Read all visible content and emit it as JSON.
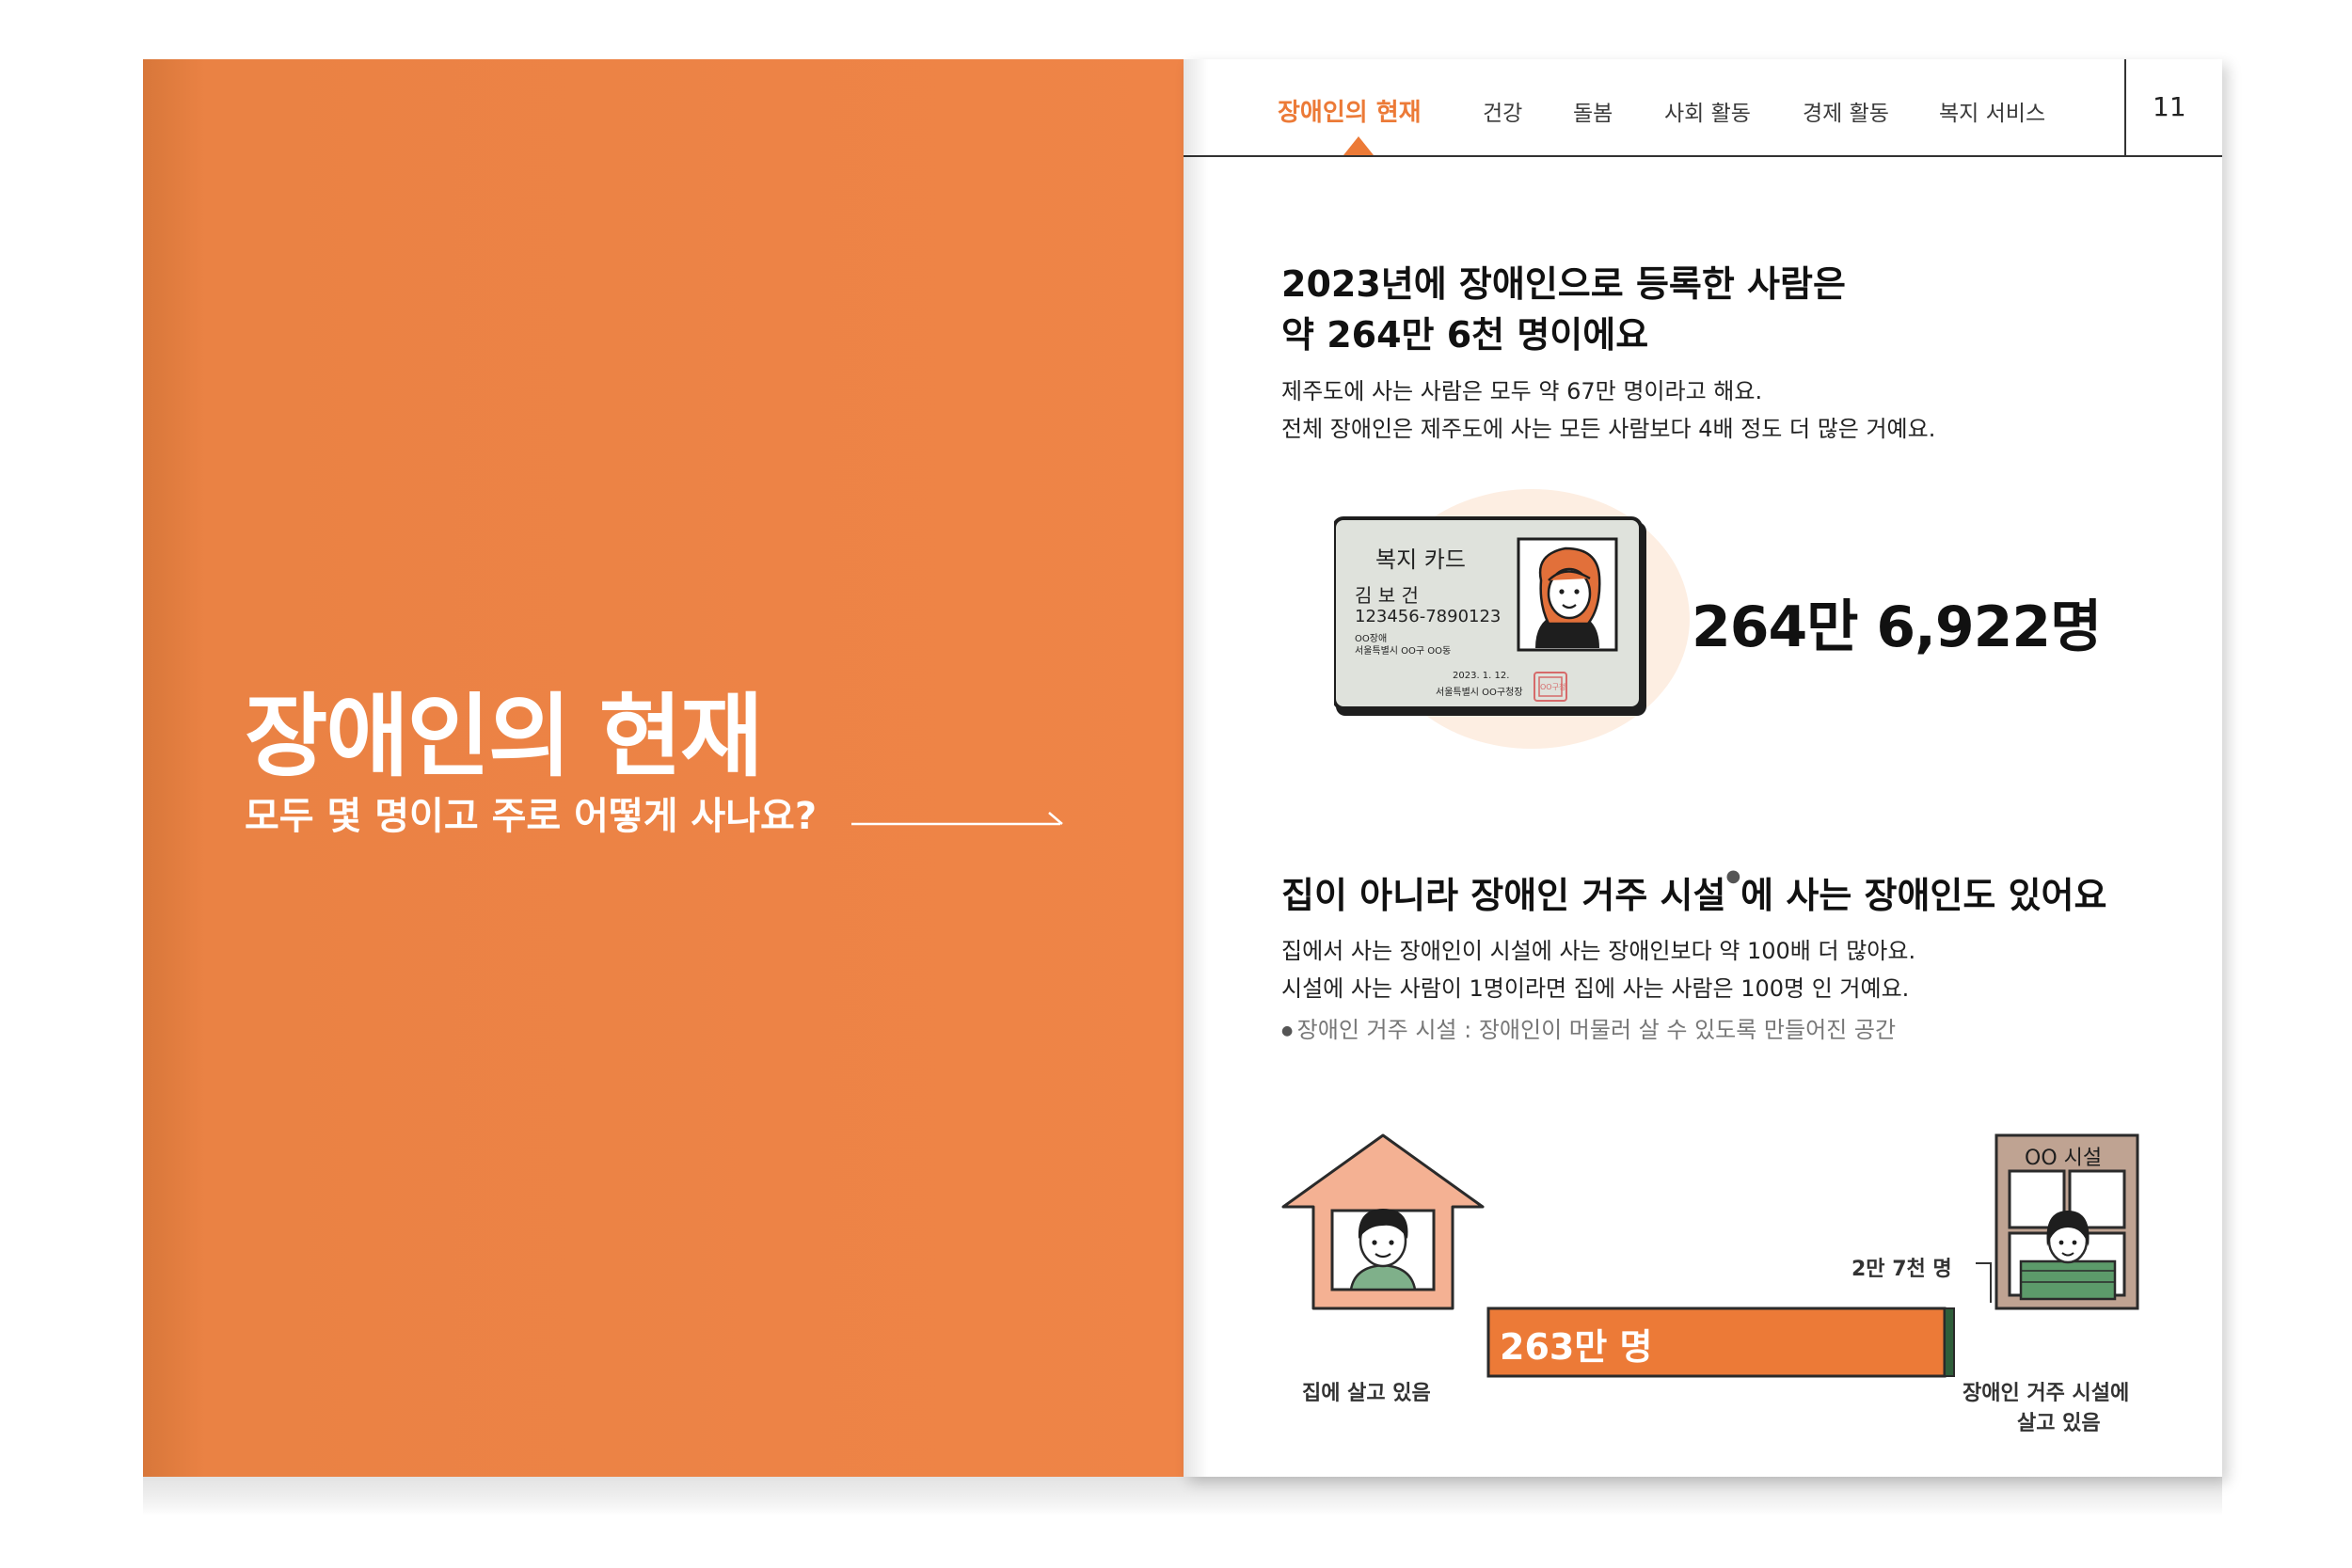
{
  "cover": {
    "title": "장애인의 현재",
    "subtitle": "모두 몇 명이고 주로 어떻게 사나요?"
  },
  "nav": {
    "items": [
      "장애인의 현재",
      "건강",
      "돌봄",
      "사회 활동",
      "경제 활동",
      "복지 서비스"
    ],
    "active_index": 0,
    "page_number": "11"
  },
  "section1": {
    "heading_line1": "2023년에 장애인으로 등록한 사람은",
    "heading_line2": "약 264만 6천 명이에요",
    "body_line1": "제주도에 사는 사람은 모두 약 67만 명이라고 해요.",
    "body_line2": "전체 장애인은 제주도에 사는 모든 사람보다 4배 정도 더 많은 거예요.",
    "card": {
      "title": "복지 카드",
      "name": "김 보 건",
      "number": "123456-7890123",
      "type": "OO장애",
      "address": "서울특별시 OO구 OO동",
      "date": "2023. 1. 12.",
      "issuer": "서울특별시 OO구청장",
      "seal_text": "OO구청"
    },
    "total": "264만 6,922명"
  },
  "section2": {
    "heading_part1": "집이 아니라 장애인 거주 시설",
    "heading_part2": "에 사는 장애인도 있어요",
    "body_line1": "집에서 사는 장애인이 시설에 사는 장애인보다 약 100배 더 많아요.",
    "body_line2": "시설에 사는 사람이 1명이라면 집에 사는 사람은 100명 인 거예요.",
    "footnote": "장애인 거주 시설 : 장애인이 머물러 살 수 있도록 만들어진 공간",
    "home_label": "집에 살고 있음",
    "facility_label_line1": "장애인 거주 시설에",
    "facility_label_line2": "살고 있음",
    "facility_sign": "OO 시설"
  },
  "chart_data": {
    "type": "bar",
    "orientation": "horizontal-stacked",
    "series": [
      {
        "name": "집에 살고 있음",
        "value": 2630000,
        "label": "263만 명",
        "color": "#ec7a37"
      },
      {
        "name": "장애인 거주 시설에 살고 있음",
        "value": 27000,
        "label": "2만 7천 명",
        "color": "#2f5e3a"
      }
    ]
  },
  "colors": {
    "accent": "#ec7a37",
    "facility": "#2f5e3a",
    "cover_bg": "#ef8447"
  }
}
